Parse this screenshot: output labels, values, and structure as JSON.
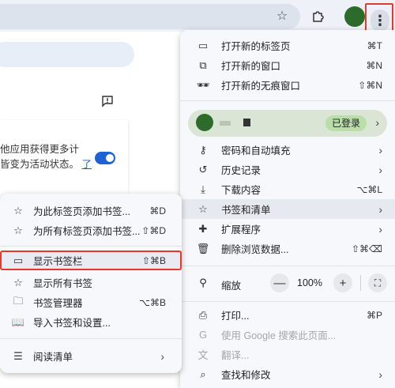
{
  "colors": {
    "accent_blue": "#1f62d8",
    "highlight_red": "#e4392b",
    "profile_green": "#2d6b2a",
    "signed_in_badge": "#b9deaa"
  },
  "background": {
    "card_text_line1": "他应用获得更多计",
    "card_text_line2": "皆变为活动状态。",
    "card_link": "了"
  },
  "menu": {
    "new_tab": {
      "label": "打开新的标签页",
      "shortcut": "⌘T"
    },
    "new_window": {
      "label": "打开新的窗口",
      "shortcut": "⌘N"
    },
    "incognito": {
      "label": "打开新的无痕窗口",
      "shortcut": "⇧⌘N"
    },
    "profile": {
      "name": "",
      "status": "已登录"
    },
    "passwords": {
      "label": "密码和自动填充"
    },
    "history": {
      "label": "历史记录"
    },
    "downloads": {
      "label": "下载内容",
      "shortcut": "⌥⌘L"
    },
    "bookmarks": {
      "label": "书签和清单"
    },
    "extensions": {
      "label": "扩展程序"
    },
    "clear_data": {
      "label": "删除浏览数据...",
      "shortcut": "⇧⌘⌫"
    },
    "zoom": {
      "label": "缩放",
      "minus": "—",
      "value": "100%",
      "plus": "+"
    },
    "print": {
      "label": "打印...",
      "shortcut": "⌘P"
    },
    "google_search": {
      "label": "使用 Google 搜索此页面..."
    },
    "translate": {
      "label": "翻译..."
    },
    "find_edit": {
      "label": "查找和修改"
    }
  },
  "bookmarks_submenu": {
    "bookmark_tab": {
      "label": "为此标签页添加书签...",
      "shortcut": "⌘D"
    },
    "bookmark_all": {
      "label": "为所有标签页添加书签...",
      "shortcut": "⇧⌘D"
    },
    "show_bar": {
      "label": "显示书签栏",
      "shortcut": "⇧⌘B"
    },
    "show_all": {
      "label": "显示所有书签"
    },
    "manager": {
      "label": "书签管理器",
      "shortcut": "⌥⌘B"
    },
    "import": {
      "label": "导入书签和设置..."
    },
    "reading_list": {
      "label": "阅读清单"
    }
  }
}
